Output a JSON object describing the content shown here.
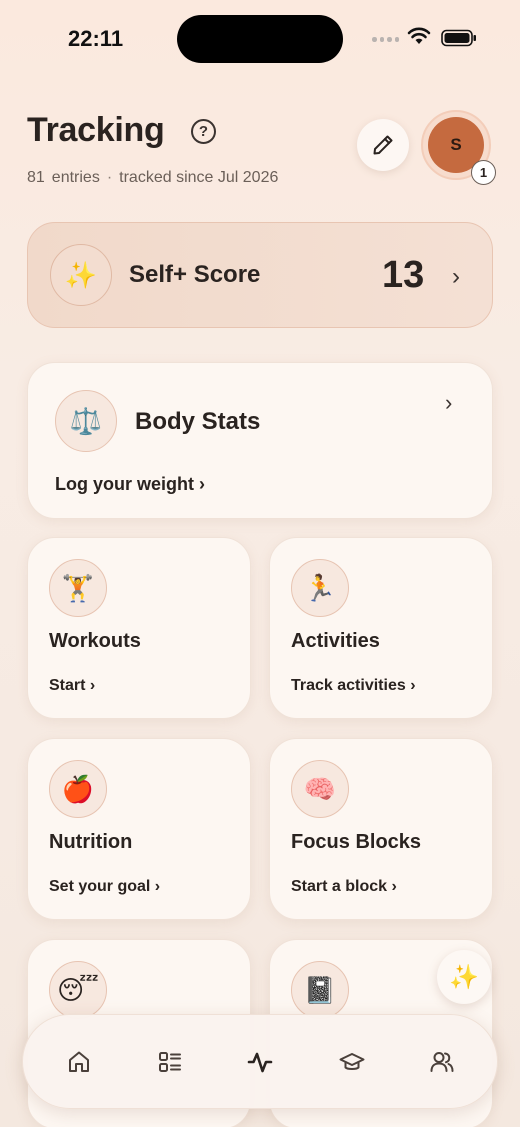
{
  "status_bar": {
    "time": "22:11"
  },
  "header": {
    "title": "Tracking",
    "help_icon": "?",
    "entries_count": "81",
    "entries_label": "entries",
    "separator": "·",
    "tracked_since": "tracked since Jul 2026",
    "avatar_initial": "S",
    "avatar_badge": "1"
  },
  "score_card": {
    "emoji": "✨",
    "label": "Self+ Score",
    "value": "13",
    "chevron": "›"
  },
  "body_stats": {
    "emoji": "⚖️",
    "title": "Body Stats",
    "action": "Log your weight ›",
    "chevron": "›"
  },
  "cards": [
    {
      "emoji": "🏋️",
      "title": "Workouts",
      "action": "Start ›"
    },
    {
      "emoji": "🏃",
      "title": "Activities",
      "action": "Track activities ›"
    },
    {
      "emoji": "🍎",
      "title": "Nutrition",
      "action": "Set your goal ›"
    },
    {
      "emoji": "🧠",
      "title": "Focus Blocks",
      "action": "Start a block ›"
    },
    {
      "emoji": "😴",
      "title": "",
      "action": ""
    },
    {
      "emoji": "📓",
      "title": "",
      "action": ""
    }
  ],
  "fab": {
    "emoji": "✨"
  },
  "tab_bar": {
    "tabs": [
      {
        "name": "home-icon",
        "active": false
      },
      {
        "name": "list-icon",
        "active": false
      },
      {
        "name": "activity-icon",
        "active": true
      },
      {
        "name": "graduation-cap-icon",
        "active": false
      },
      {
        "name": "people-icon",
        "active": false
      }
    ]
  },
  "colors": {
    "accent": "#c56a3f",
    "background": "#f8ece4",
    "card": "#fdf7f2",
    "text": "#2a2320"
  }
}
